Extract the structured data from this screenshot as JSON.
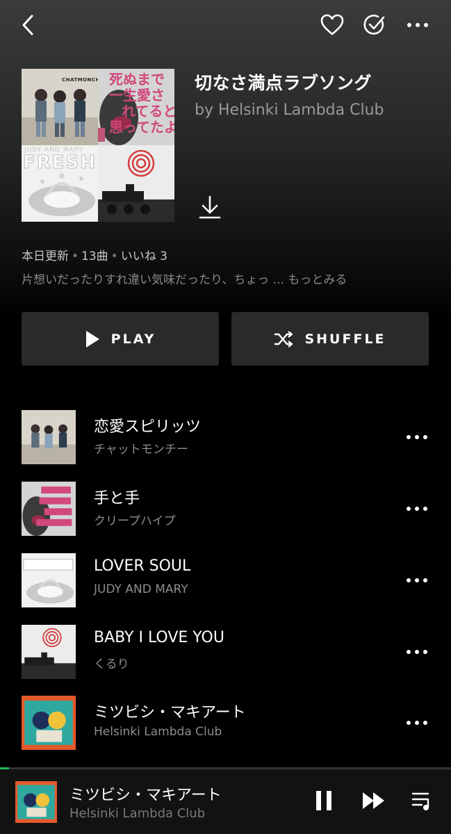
{
  "playlist": {
    "title": "切なさ満点ラブソング",
    "byline": "by Helsinki Lambda Club",
    "updated": "本日更新",
    "track_count": "13曲",
    "likes": "いいね 3",
    "description": "片想いだったりすれ違い気味だったり、ちょっ ... もっとみる"
  },
  "cover_text": {
    "a1": "CHATMONCHY",
    "b1": "死ぬまで",
    "b2": "一生愛さ",
    "b3": "れてると",
    "b4": "思ってたよ",
    "c1": "JUDY AND MARY",
    "c2": "FRESH"
  },
  "buttons": {
    "play": "PLAY",
    "shuffle": "SHUFFLE"
  },
  "tracks": [
    {
      "title": "恋愛スピリッツ",
      "artist": "チャットモンチー"
    },
    {
      "title": "手と手",
      "artist": "クリープハイプ"
    },
    {
      "title": "LOVER SOUL",
      "artist": "JUDY AND MARY"
    },
    {
      "title": "BABY I LOVE YOU",
      "artist": "くるり"
    },
    {
      "title": "ミツビシ・マキアート",
      "artist": "Helsinki Lambda Club"
    }
  ],
  "now_playing": {
    "title": "ミツビシ・マキアート",
    "artist": "Helsinki Lambda Club",
    "progress": 0.02
  },
  "colors": {
    "accent": "#1db954",
    "background": "#000000",
    "button_bg": "#2a2a2a"
  }
}
